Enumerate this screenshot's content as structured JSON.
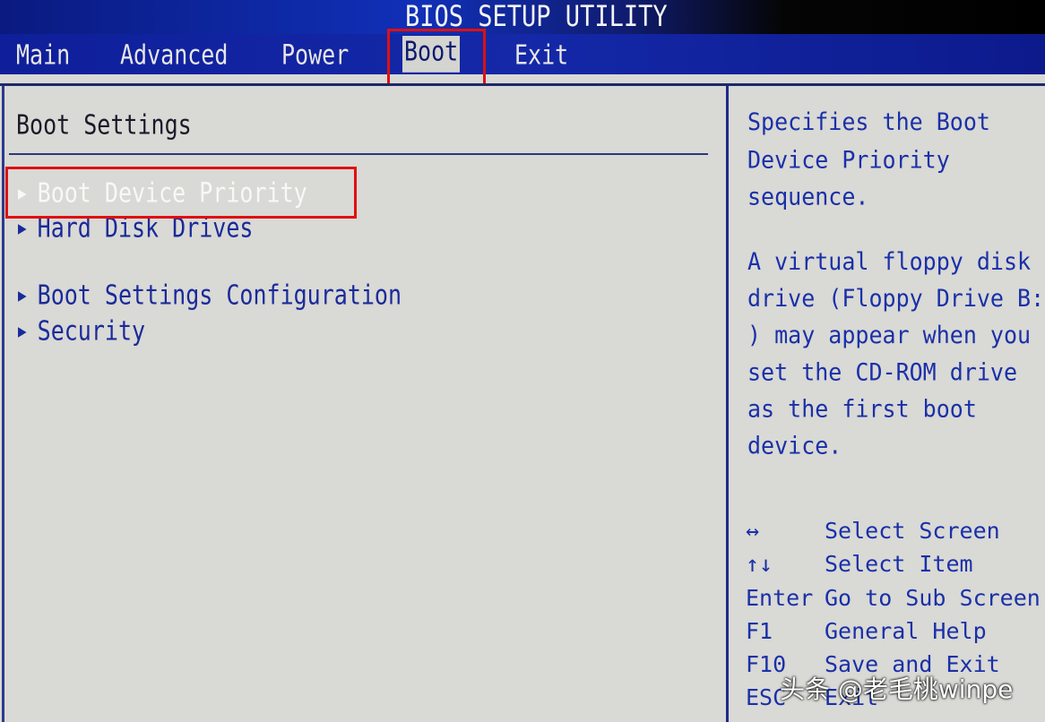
{
  "header": {
    "title": "BIOS SETUP UTILITY"
  },
  "tabs": [
    {
      "label": "Main"
    },
    {
      "label": "Advanced"
    },
    {
      "label": "Power"
    },
    {
      "label": "Boot",
      "active": true
    },
    {
      "label": "Exit"
    }
  ],
  "main": {
    "heading": "Boot Settings",
    "items": [
      {
        "label": "Boot Device Priority",
        "selected": true
      },
      {
        "label": "Hard Disk Drives"
      },
      {
        "label": "Boot Settings Configuration"
      },
      {
        "label": "Security"
      }
    ],
    "arrow_icon": "triangle-right-icon"
  },
  "help": {
    "description": "Specifies the Boot\nDevice Priority\nsequence.",
    "note": "A virtual floppy disk\ndrive (Floppy Drive B:\n) may appear when you\nset the CD-ROM drive\nas the first boot\ndevice.",
    "keys": [
      {
        "key": "↔",
        "action": "Select Screen"
      },
      {
        "key": "↑↓",
        "action": "Select Item"
      },
      {
        "key": "Enter",
        "action": "Go to Sub Screen"
      },
      {
        "key": "F1",
        "action": "General Help"
      },
      {
        "key": "F10",
        "action": "Save and Exit"
      },
      {
        "key": "ESC",
        "action": "Exit"
      }
    ]
  },
  "watermark": "头条 @老毛桃winpe",
  "colors": {
    "tab_bar": "#1428a8",
    "background": "#d9d9d5",
    "text_blue": "#1a30a8",
    "highlight_box": "#e01010"
  }
}
